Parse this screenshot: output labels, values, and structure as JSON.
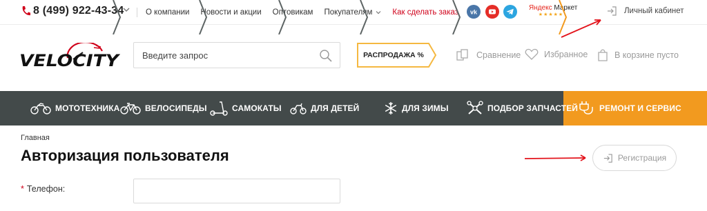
{
  "topbar": {
    "phone": "8 (499) 922-43-34",
    "nav": [
      {
        "label": "О компании",
        "dropdown": false,
        "highlight": false
      },
      {
        "label": "Новости и акции",
        "dropdown": false,
        "highlight": false
      },
      {
        "label": "Оптовикам",
        "dropdown": false,
        "highlight": false
      },
      {
        "label": "Покупателям",
        "dropdown": true,
        "highlight": false
      },
      {
        "label": "Как сделать заказ",
        "dropdown": false,
        "highlight": true
      }
    ],
    "social_icons": [
      "vk-icon",
      "youtube-icon",
      "telegram-icon"
    ],
    "yandex_market": {
      "brand": "Яндекс",
      "name": "Маркет",
      "stars": "★★★★★"
    },
    "cabinet_label": "Личный кабинет"
  },
  "header": {
    "logo_text": "VELOCITY",
    "search_placeholder": "Введите запрос",
    "sale_label": "РАСПРОДАЖА %",
    "compare_label": "Сравнение",
    "favorites_label": "Избранное",
    "cart_label": "В корзине пусто"
  },
  "categories": [
    {
      "label": "МОТОТЕХНИКА",
      "icon": "motorcycle-icon"
    },
    {
      "label": "ВЕЛОСИПЕДЫ",
      "icon": "bicycle-icon"
    },
    {
      "label": "САМОКАТЫ",
      "icon": "scooter-icon"
    },
    {
      "label": "ДЛЯ ДЕТЕЙ",
      "icon": "kids-bike-icon"
    },
    {
      "label": "ДЛЯ ЗИМЫ",
      "icon": "snowflake-icon"
    },
    {
      "label": "ПОДБОР ЗАПЧАСТЕЙ",
      "icon": "wrenches-icon"
    },
    {
      "label": "РЕМОНТ И СЕРВИС",
      "icon": "plug-icon"
    }
  ],
  "page": {
    "breadcrumb": "Главная",
    "title": "Авторизация пользователя",
    "register_label": "Регистрация",
    "phone_label": "Телефон:",
    "required_mark": "*"
  },
  "colors": {
    "accent_red": "#d0021b",
    "nav_bg": "#434a4a",
    "service_bg": "#f29a1f",
    "sale_border": "#f5b840",
    "annotation_arrow": "#e3131b"
  }
}
